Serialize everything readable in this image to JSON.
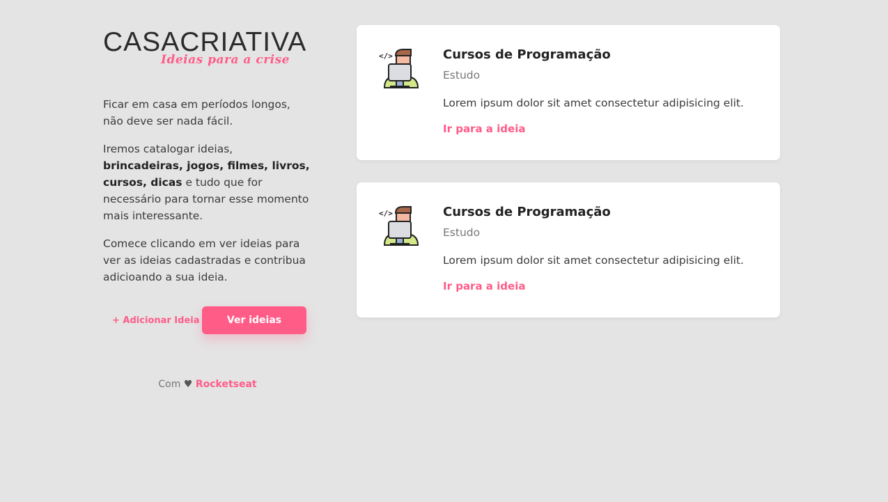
{
  "logo": {
    "part1": "CASA",
    "part2": "CRIATIVA",
    "tagline": "Ideias para a crise"
  },
  "intro": {
    "p1": "Ficar em casa em períodos longos, não deve ser nada fácil.",
    "p2_start": "Iremos catalogar ideias, ",
    "p2_bold": "brincadeiras, jogos, filmes, livros, cursos, dicas",
    "p2_end": " e tudo que for necessário para tornar esse momento mais interessante.",
    "p3": "Comece clicando em ver ideias para ver as ideias cadastradas e contribua adicioando a sua ideia."
  },
  "actions": {
    "add_label": "+ Adicionar Ideia",
    "view_label": "Ver ideias"
  },
  "footer": {
    "prefix": "Com",
    "heart": "♥",
    "brand": "Rocketseat"
  },
  "cards": [
    {
      "title": "Cursos de Programação",
      "category": "Estudo",
      "description": "Lorem ipsum dolor sit amet consectetur adipisicing elit.",
      "link": "Ir para a ideia",
      "icon": "programmer-icon"
    },
    {
      "title": "Cursos de Programação",
      "category": "Estudo",
      "description": "Lorem ipsum dolor sit amet consectetur adipisicing elit.",
      "link": "Ir para a ideia",
      "icon": "programmer-icon"
    }
  ],
  "colors": {
    "accent": "#ff5c88",
    "background": "#e4e4e4",
    "card": "#ffffff"
  }
}
